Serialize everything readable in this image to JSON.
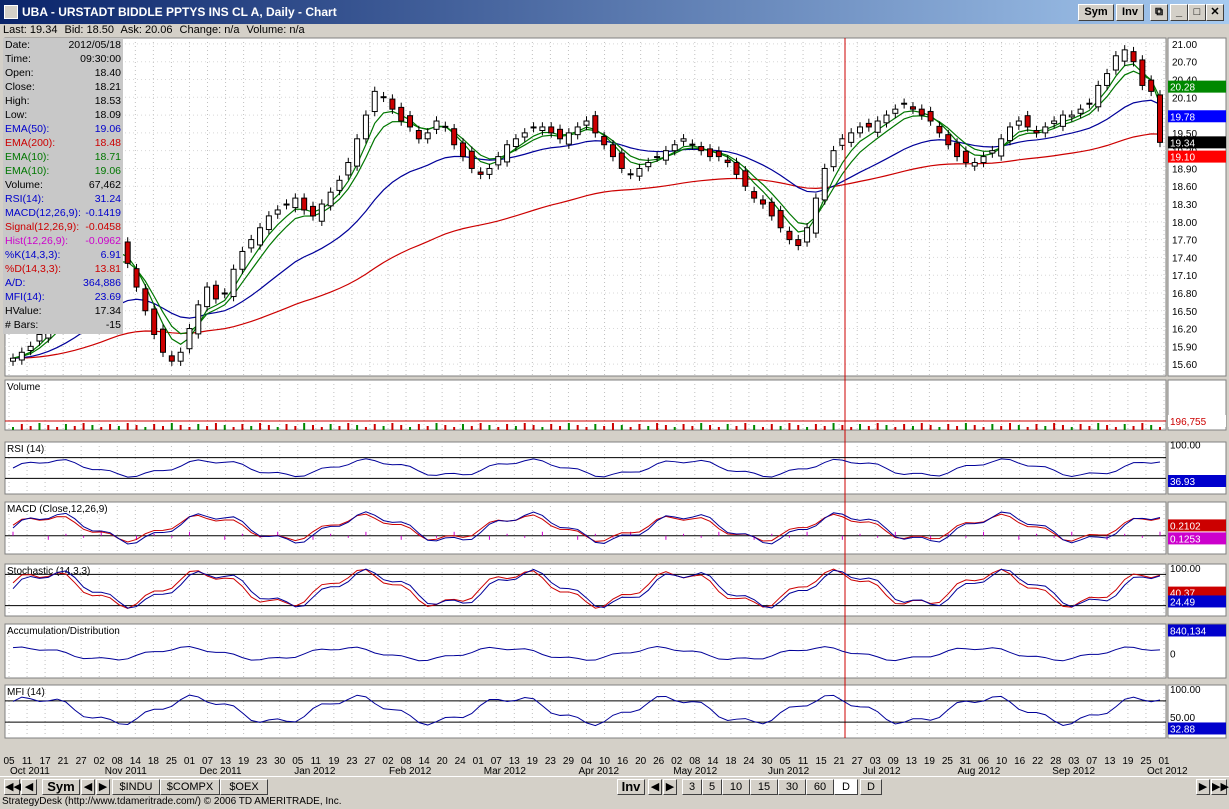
{
  "window": {
    "title": "UBA - URSTADT BIDDLE PPTYS INS CL A, Daily - Chart",
    "sym_button": "Sym",
    "inv_button": "Inv"
  },
  "quote_bar": {
    "last": "Last: 19.34",
    "bid": "Bid: 18.50",
    "ask": "Ask: 20.06",
    "change": "Change: n/a",
    "volume": "Volume: n/a"
  },
  "info_panel": [
    {
      "label": "Date:",
      "value": "2012/05/18",
      "color": "#000000"
    },
    {
      "label": "Time:",
      "value": "09:30:00",
      "color": "#000000"
    },
    {
      "label": "Open:",
      "value": "18.40",
      "color": "#000000"
    },
    {
      "label": "Close:",
      "value": "18.21",
      "color": "#000000"
    },
    {
      "label": "High:",
      "value": "18.53",
      "color": "#000000"
    },
    {
      "label": "Low:",
      "value": "18.09",
      "color": "#000000"
    },
    {
      "label": "EMA(50):",
      "value": "19.06",
      "color": "#0000cc"
    },
    {
      "label": "EMA(200):",
      "value": "18.48",
      "color": "#cc0000"
    },
    {
      "label": "EMA(10):",
      "value": "18.71",
      "color": "#007700"
    },
    {
      "label": "EMA(10):",
      "value": "19.06",
      "color": "#007700"
    },
    {
      "label": "Volume:",
      "value": "67,462",
      "color": "#000000"
    },
    {
      "label": "RSI(14):",
      "value": "31.24",
      "color": "#0000cc"
    },
    {
      "label": "MACD(12,26,9):",
      "value": "-0.1419",
      "color": "#0000cc"
    },
    {
      "label": "Signal(12,26,9):",
      "value": "-0.0458",
      "color": "#cc0000"
    },
    {
      "label": "Hist(12,26,9):",
      "value": "-0.0962",
      "color": "#cc00cc"
    },
    {
      "label": "%K(14,3,3):",
      "value": "6.91",
      "color": "#0000cc"
    },
    {
      "label": "%D(14,3,3):",
      "value": "13.81",
      "color": "#cc0000"
    },
    {
      "label": "A/D:",
      "value": "364,886",
      "color": "#0000cc"
    },
    {
      "label": "MFI(14):",
      "value": "23.69",
      "color": "#0000cc"
    },
    {
      "label": "HValue:",
      "value": "17.34",
      "color": "#000000"
    },
    {
      "label": "# Bars:",
      "value": "-15",
      "color": "#000000"
    }
  ],
  "chart_data": {
    "type": "candlestick",
    "price_axis_ticks": [
      "21.00",
      "20.70",
      "20.40",
      "20.10",
      "19.80",
      "19.50",
      "19.20",
      "18.90",
      "18.60",
      "18.30",
      "18.00",
      "17.70",
      "17.40",
      "17.10",
      "16.80",
      "16.50",
      "16.20",
      "15.90",
      "15.60"
    ],
    "ylim": [
      15.4,
      21.1
    ],
    "closes": [
      15.7,
      15.8,
      15.9,
      16.1,
      16.3,
      16.5,
      16.7,
      16.9,
      17.1,
      17.3,
      17.5,
      17.7,
      17.6,
      17.3,
      16.9,
      16.5,
      16.1,
      15.8,
      15.65,
      15.8,
      16.2,
      16.6,
      16.9,
      16.7,
      16.8,
      17.2,
      17.5,
      17.7,
      17.9,
      18.1,
      18.2,
      18.3,
      18.4,
      18.2,
      18.1,
      18.3,
      18.5,
      18.7,
      19.0,
      19.4,
      19.8,
      20.2,
      20.1,
      19.9,
      19.7,
      19.6,
      19.4,
      19.5,
      19.7,
      19.6,
      19.3,
      19.1,
      18.9,
      18.8,
      18.9,
      19.1,
      19.3,
      19.4,
      19.5,
      19.6,
      19.6,
      19.5,
      19.4,
      19.5,
      19.6,
      19.7,
      19.5,
      19.3,
      19.1,
      18.9,
      18.8,
      18.9,
      19.0,
      19.1,
      19.2,
      19.3,
      19.4,
      19.3,
      19.2,
      19.1,
      19.1,
      19.0,
      18.8,
      18.6,
      18.4,
      18.3,
      18.1,
      17.9,
      17.7,
      17.6,
      17.9,
      18.4,
      18.9,
      19.2,
      19.4,
      19.5,
      19.6,
      19.6,
      19.7,
      19.8,
      19.9,
      20.0,
      19.9,
      19.8,
      19.7,
      19.5,
      19.3,
      19.1,
      19.0,
      19.0,
      19.1,
      19.2,
      19.4,
      19.6,
      19.7,
      19.6,
      19.5,
      19.6,
      19.7,
      19.8,
      19.8,
      19.9,
      20.0,
      20.3,
      20.5,
      20.8,
      20.9,
      20.7,
      20.3,
      20.2,
      19.34
    ],
    "price_labels": [
      {
        "text": "20.28",
        "value": 20.28,
        "color": "#008800"
      },
      {
        "text": "19.78",
        "value": 19.78,
        "color": "#0000ff"
      },
      {
        "text": "19.34",
        "value": 19.34,
        "color": "#000000"
      },
      {
        "text": "19.10",
        "value": 19.1,
        "color": "#ff0000"
      }
    ],
    "volume": {
      "title": "Volume",
      "last_label": "196,755"
    },
    "rsi": {
      "title": "RSI (14)",
      "top_tick": "100.00",
      "last_label": "36.93"
    },
    "macd": {
      "title": "MACD (Close,12,26,9)",
      "label_macd": "0.2102",
      "label_signal": "0.1253"
    },
    "stochastic": {
      "title": "Stochastic (14,3,3)",
      "top_tick": "100.00",
      "label_d": "40.37",
      "label_k": "24.49"
    },
    "ad": {
      "title": "Accumulation/Distribution",
      "label": "840,134",
      "zero_tick": "0"
    },
    "mfi": {
      "title": "MFI (14)",
      "top_tick": "100.00",
      "mid_tick": "50.00",
      "last_label": "32.88"
    },
    "x_day_labels": [
      "05",
      "11",
      "17",
      "21",
      "27",
      "02",
      "08",
      "14",
      "18",
      "25",
      "01",
      "07",
      "13",
      "19",
      "23",
      "30",
      "05",
      "11",
      "19",
      "23",
      "27",
      "02",
      "08",
      "14",
      "20",
      "24",
      "01",
      "07",
      "13",
      "19",
      "23",
      "29",
      "04",
      "10",
      "16",
      "20",
      "26",
      "02",
      "08",
      "14",
      "18",
      "24",
      "30",
      "05",
      "11",
      "15",
      "21",
      "27",
      "03",
      "09",
      "13",
      "19",
      "25",
      "31",
      "06",
      "10",
      "16",
      "22",
      "28",
      "03",
      "07",
      "13",
      "19",
      "25",
      "01"
    ],
    "x_month_labels": [
      "Oct 2011",
      "Nov 2011",
      "Dec 2011",
      "Jan 2012",
      "Feb 2012",
      "Mar 2012",
      "Apr 2012",
      "May 2012",
      "Jun 2012",
      "Jul 2012",
      "Aug 2012",
      "Sep 2012",
      "Oct 2012"
    ]
  },
  "bottom_bar": {
    "sym": "Sym",
    "tabs": [
      "$INDU",
      "$COMPX",
      "$OEX"
    ],
    "inv": "Inv",
    "periods": [
      "3",
      "5",
      "10",
      "15",
      "30",
      "60",
      "D"
    ],
    "active_period": "D"
  },
  "status_text": "StrategyDesk (http://www.tdameritrade.com/) © 2006 TD AMERITRADE, Inc."
}
